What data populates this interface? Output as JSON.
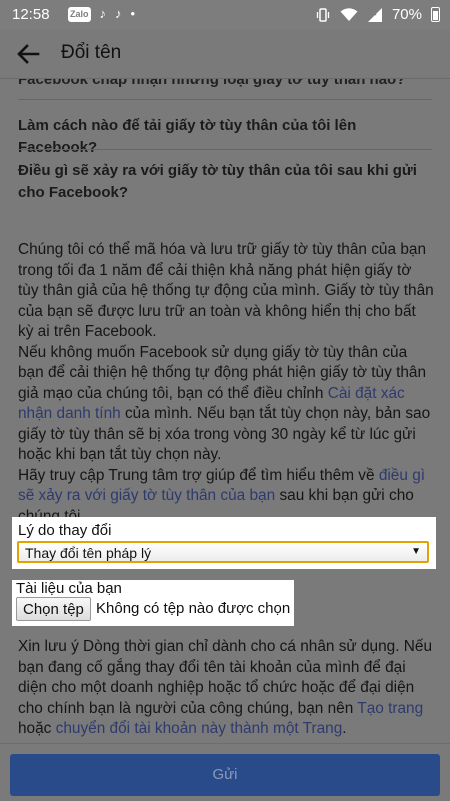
{
  "status_bar": {
    "time": "12:58",
    "app_icons": [
      "zalo-icon",
      "tiktok-icon",
      "tiktok-icon",
      "dot-icon"
    ],
    "zalo_label": "Zalo",
    "battery": "70%",
    "system_icons": [
      "vibrate-icon",
      "wifi-icon",
      "signal-icon",
      "battery-icon"
    ]
  },
  "header": {
    "title": "Đổi tên"
  },
  "faq": {
    "cut_off_question": "Facebook chấp nhận những loại giấy tờ tùy thân nào?",
    "q1": "Làm cách nào để tải giấy tờ tùy thân của tôi lên Facebook?",
    "q2": "Điều gì sẽ xảy ra với giấy tờ tùy thân của tôi sau khi gửi cho Facebook?"
  },
  "body": {
    "para1": "Chúng tôi có thể mã hóa và lưu trữ giấy tờ tùy thân của bạn trong tối đa 1 năm để cải thiện khả năng phát hiện giấy tờ tùy thân giả của hệ thống tự động của mình. Giấy tờ tùy thân của bạn sẽ được lưu trữ an toàn và không hiển thị cho bất kỳ ai trên Facebook.",
    "para2_a": "Nếu không muốn Facebook sử dụng giấy tờ tùy thân của bạn để cải thiện hệ thống tự động phát hiện giấy tờ tùy thân giả mạo của chúng tôi, bạn có thể điều chỉnh ",
    "para2_link": "Cài đặt xác nhận danh tính",
    "para2_b": " của mình. Nếu bạn tắt tùy chọn này, bản sao giấy tờ tùy thân sẽ bị xóa trong vòng 30 ngày kể từ lúc gửi hoặc khi bạn tắt tùy chọn này.",
    "para3_a": "Hãy truy cập Trung tâm trợ giúp để tìm hiểu thêm về ",
    "para3_link": "điều gì sẽ xảy ra với giấy tờ tùy thân của bạn",
    "para3_b": " sau khi bạn gửi cho chúng tôi."
  },
  "reason": {
    "label": "Lý do thay đổi",
    "selected": "Thay đổi tên pháp lý"
  },
  "documents": {
    "label": "Tài liệu của bạn",
    "choose_button": "Chọn tệp",
    "no_file_text": "Không có tệp nào được chọn"
  },
  "note": {
    "text_a": "Xin lưu ý Dòng thời gian chỉ dành cho cá nhân sử dụng. Nếu bạn đang cố gắng thay đổi tên tài khoản của mình để đại diện cho một doanh nghiệp hoặc tổ chức hoặc để đại diện cho chính bạn là người của công chúng, bạn nên ",
    "link1": "Tạo trang",
    "text_b": " hoặc ",
    "link2": "chuyển đổi tài khoản này thành một Trang",
    "text_c": "."
  },
  "footer": {
    "send_label": "Gửi"
  },
  "colors": {
    "dim_background": "#7a7a7a",
    "link": "#2e3a6e",
    "send_button": "#2a4b8a",
    "select_border": "#e2a300"
  }
}
